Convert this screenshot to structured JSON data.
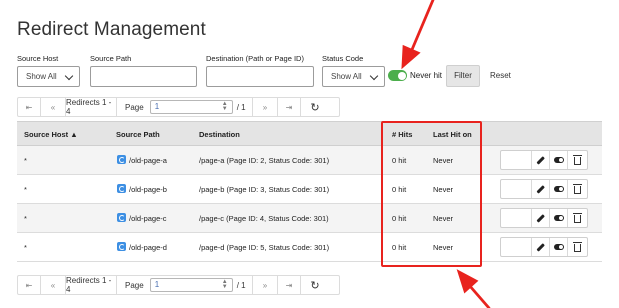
{
  "page": {
    "title": "Redirect Management"
  },
  "filters": {
    "source_host_label": "Source Host",
    "source_host_value": "Show All",
    "source_path_label": "Source Path",
    "destination_label": "Destination (Path or Page ID)",
    "status_code_label": "Status Code",
    "status_code_value": "Show All",
    "never_hit_label": "Never hit",
    "never_hit_on": true,
    "filter_button": "Filter",
    "reset_button": "Reset"
  },
  "pager": {
    "first": "⇤",
    "prev": "«",
    "info": "Redirects 1 - 4",
    "page_label": "Page",
    "page_value": "1",
    "of_label": "/ 1",
    "next": "»",
    "last": "⇥",
    "refresh": "↻"
  },
  "table": {
    "headers": {
      "source_host": "Source Host ▲",
      "source_path": "Source Path",
      "destination": "Destination",
      "hits": "# Hits",
      "last_hit": "Last Hit on"
    },
    "rows": [
      {
        "host": "*",
        "path": "/old-page-a",
        "dest": "/page-a (Page ID: 2, Status Code: 301)",
        "hits": "0 hit",
        "last": "Never"
      },
      {
        "host": "*",
        "path": "/old-page-b",
        "dest": "/page-b (Page ID: 3, Status Code: 301)",
        "hits": "0 hit",
        "last": "Never"
      },
      {
        "host": "*",
        "path": "/old-page-c",
        "dest": "/page-c (Page ID: 4, Status Code: 301)",
        "hits": "0 hit",
        "last": "Never"
      },
      {
        "host": "*",
        "path": "/old-page-d",
        "dest": "/page-d (Page ID: 5, Status Code: 301)",
        "hits": "0 hit",
        "last": "Never"
      }
    ]
  },
  "colors": {
    "highlight": "#e8231e",
    "toggle_on": "#4cae4c",
    "link_icon": "#3d8fe3"
  }
}
